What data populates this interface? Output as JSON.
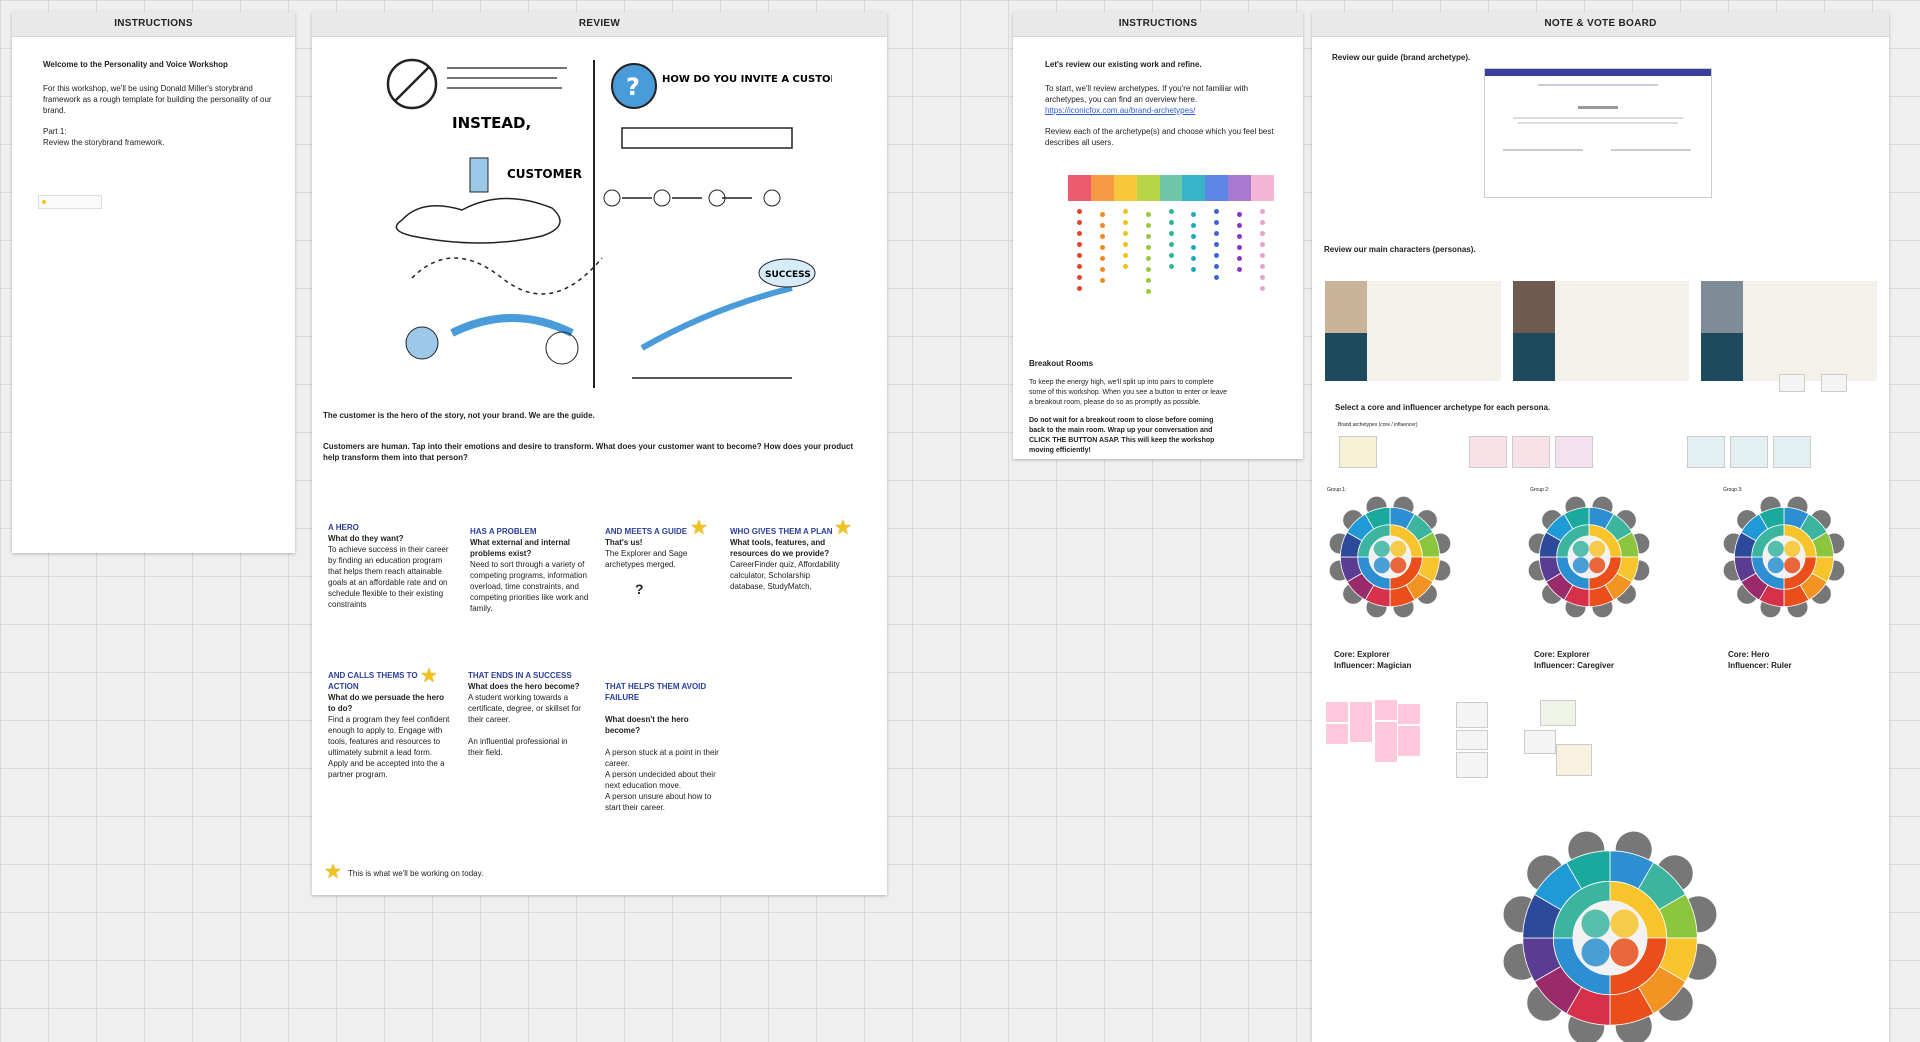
{
  "frames": {
    "instructions1": {
      "title": "INSTRUCTIONS",
      "welcome": "Welcome to the Personality and Voice Workshop",
      "intro": "For this workshop, we'll be using Donald Miller's storybrand framework as a rough template for building the personality of our brand.",
      "part": "Part 1:",
      "part_desc": "Review the storybrand framework."
    },
    "review": {
      "title": "REVIEW",
      "sketch_left_heading": "INSTEAD,",
      "sketch_right_heading": "HOW DO YOU INVITE A CUSTOMER INTO A STORY?",
      "sketch_customer": "CUSTOMER",
      "sketch_success": "SUCCESS",
      "hero_statement": "The customer is the hero of the story, not your brand. We are the guide.",
      "human_statement": "Customers are human. Tap into their emotions and desire to transform. What does your customer want to become? How does your product help transform them into that person?",
      "cards": [
        {
          "heading": "A HERO",
          "question": "What do they want?",
          "body": "To achieve success in their career by finding an education program that helps them reach attainable goals at an affordable rate and on schedule flexible to their existing constraints",
          "star": false
        },
        {
          "heading": "HAS A PROBLEM",
          "question": "What external and internal problems exist?",
          "body": "Need to sort through a variety of competing programs, information overload, time constraints, and competing priorities like work and family.",
          "star": false
        },
        {
          "heading": "AND MEETS A GUIDE",
          "question": "That's us!",
          "body": "The Explorer and Sage archetypes merged.",
          "extra": "?",
          "star": true
        },
        {
          "heading": "WHO GIVES THEM A PLAN",
          "question": "What tools, features, and resources do we provide?",
          "body": "CareerFinder quiz, Affordability calculator, Scholarship database, StudyMatch,",
          "star": true
        },
        {
          "heading": "AND CALLS THEMS TO ACTION",
          "question": "What do we persuade the hero to do?",
          "body": "Find a program they feel confident enough to apply to. Engage with tools, features and resources to ultimately submit a lead form. Apply and be accepted into the a partner program.",
          "star": true
        },
        {
          "heading": "THAT ENDS IN A SUCCESS",
          "question": "What does the hero become?",
          "body": "A student working towards a certificate, degree, or skillset for their career.",
          "body2": "An influential professional in their field.",
          "star": false
        },
        {
          "heading": "THAT HELPS THEM AVOID FAILURE",
          "question": "What doesn't the hero become?",
          "body": "A person stuck at a point in their career.\nA person undecided about their next education move.\nA person unsure about how to start their career.",
          "star": false
        }
      ],
      "legend": "This is what we'll be working on today."
    },
    "instructions2": {
      "title": "INSTRUCTIONS",
      "heading": "Let's review our existing work and refine.",
      "p1": "To start, we'll review archetypes. If you're not familiar with archetypes, you can find an overview here.",
      "link": "https://iconicfox.com.au/brand-archetypes/",
      "p2": "Review each of the archetype(s) and choose which you feel best describes all users.",
      "breakout_title": "Breakout Rooms",
      "breakout_p1": "To keep the energy high, we'll split up into pairs to complete some of this workshop. When you see a button to enter or leave a breakout room, please do so as promptly as possible.",
      "breakout_p2": "Do not wait for a breakout room to close before coming back to the main room. Wrap up your conversation and CLICK THE BUTTON ASAP. This will keep the workshop moving efficiently!"
    },
    "board": {
      "title": "NOTE & VOTE BOARD",
      "review_guide": "Review our guide (brand archetype).",
      "review_chars": "Review our main characters (personas).",
      "select_label": "Select a core and influencer archetype for each persona.",
      "brand_archetypes_label": "Brand archetypes (core / influencer)",
      "groups": [
        {
          "label": "Group 1:",
          "core": "Core: Explorer",
          "influencer": "Influencer: Magician"
        },
        {
          "label": "Group 2:",
          "core": "Core: Explorer",
          "influencer": "Influencer: Caregiver"
        },
        {
          "label": "Group 3:",
          "core": "Core: Hero",
          "influencer": "Influencer: Ruler"
        }
      ]
    }
  },
  "palette": [
    "#ec5a6e",
    "#f59b45",
    "#f6c83a",
    "#b6d445",
    "#6fc6a8",
    "#39b3c7",
    "#5d86e6",
    "#a77ad0",
    "#f5b6d5"
  ],
  "dot_colors": [
    "#e8422f",
    "#f08a1f",
    "#efc31c",
    "#98c93c",
    "#2fb59a",
    "#1fa7c0",
    "#4163d8",
    "#8a36c2",
    "#e7a3cf"
  ],
  "wheel_colors": [
    "#2b8fd1",
    "#3bb5a0",
    "#8cc63f",
    "#f7c42b",
    "#f39322",
    "#e94e1b",
    "#d6304b",
    "#9a2b6b",
    "#5b3c93",
    "#2d4a9a",
    "#1f9ad6",
    "#19a99d"
  ]
}
